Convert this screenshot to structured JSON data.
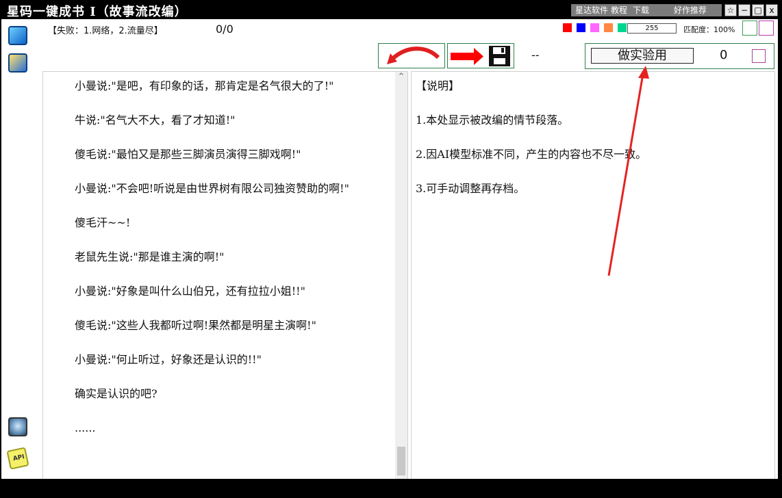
{
  "app": {
    "title": "星码一键成书 I（故事流改编）",
    "links": {
      "software": "星达软件",
      "tutorial": "教程",
      "download": "下载",
      "recommend": "好作推荐"
    },
    "window_buttons": [
      "☆",
      "−",
      "□",
      "x"
    ]
  },
  "toolbar": {
    "status": "【失败：1.网络，2.流量尽】",
    "counter": "0/0",
    "level_value": "255",
    "match_label": "匹配度：100%",
    "dash": "--",
    "experiment_label": "做实验用",
    "experiment_count": "0",
    "colors": [
      "#ff0000",
      "#0000ff",
      "#ff66ff",
      "#ff8844",
      "#00d68f"
    ]
  },
  "story": {
    "lines": [
      "小曼说:\"是吧，有印象的话，那肯定是名气很大的了!\"",
      "牛说:\"名气大不大，看了才知道!\"",
      "傻毛说:\"最怕又是那些三脚演员演得三脚戏啊!\"",
      "小曼说:\"不会吧!听说是由世界树有限公司独资赞助的啊!\"",
      "傻毛汗~~!",
      "老鼠先生说:\"那是谁主演的啊!\"",
      "小曼说:\"好象是叫什么山伯兄，还有拉拉小姐!!\"",
      "傻毛说:\"这些人我都听过啊!果然都是明星主演啊!\"",
      "小曼说:\"何止听过，好象还是认识的!!\"",
      "确实是认识的吧?",
      "......"
    ]
  },
  "notes": {
    "heading": "【说明】",
    "items": [
      "1.本处显示被改编的情节段落。",
      "2.因AI模型标准不同，产生的内容也不尽一致。",
      "3.可手动调整再存档。"
    ]
  }
}
